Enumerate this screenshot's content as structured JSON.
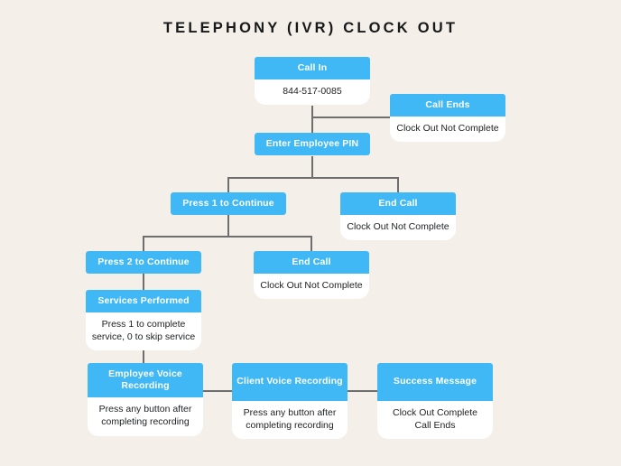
{
  "page": {
    "title": "Telephony (IVR) Clock Out",
    "background_color": "#f4efe8",
    "accent_color": "#40b8f5",
    "line_color": "#6e6e6e",
    "text_color": "#1d1f21"
  },
  "nodes": {
    "call_in": {
      "header": "Call In",
      "body_line1": "844-517-0085"
    },
    "call_ends": {
      "header": "Call Ends",
      "body_line1": "Clock Out Not Complete"
    },
    "enter_pin": {
      "header": "Enter Employee PIN"
    },
    "press_1_continue": {
      "header": "Press 1 to Continue"
    },
    "end_call_1": {
      "header": "End Call",
      "body_line1": "Clock Out Not Complete"
    },
    "press_2_continue": {
      "header": "Press 2 to Continue"
    },
    "end_call_2": {
      "header": "End Call",
      "body_line1": "Clock Out Not Complete"
    },
    "services_performed": {
      "header": "Services Performed",
      "body_line1": "Press 1 to complete",
      "body_line2": "service, 0 to skip service"
    },
    "employee_voice_recording": {
      "header_line1": "Employee Voice",
      "header_line2": "Recording",
      "body_line1": "Press any button after",
      "body_line2": "completing recording"
    },
    "client_voice_recording": {
      "header": "Client Voice Recording",
      "body_line1": "Press any button after",
      "body_line2": "completing recording"
    },
    "success_message": {
      "header": "Success Message",
      "body_line1": "Clock Out Complete",
      "body_line2": "Call Ends"
    }
  }
}
